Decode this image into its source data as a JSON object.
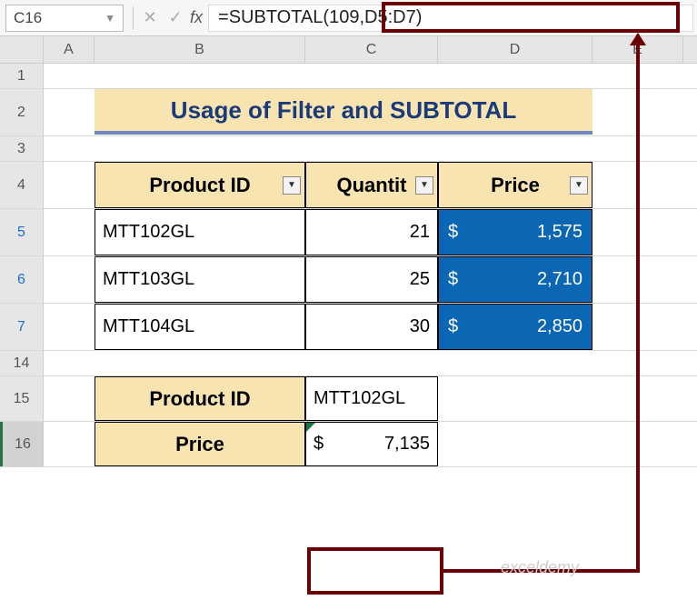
{
  "nameBox": "C16",
  "formula": "=SUBTOTAL(109,D5:D7)",
  "columns": [
    "A",
    "B",
    "C",
    "D",
    "E"
  ],
  "rowLabels": {
    "r1": "1",
    "r2": "2",
    "r3": "3",
    "r4": "4",
    "r5": "5",
    "r6": "6",
    "r7": "7",
    "r14": "14",
    "r15": "15",
    "r16": "16"
  },
  "title": "Usage of Filter and SUBTOTAL",
  "headers": {
    "product": "Product ID",
    "qty": "Quantit",
    "price": "Price"
  },
  "data": [
    {
      "id": "MTT102GL",
      "qty": "21",
      "cur": "$",
      "price": "1,575"
    },
    {
      "id": "MTT103GL",
      "qty": "25",
      "cur": "$",
      "price": "2,710"
    },
    {
      "id": "MTT104GL",
      "qty": "30",
      "cur": "$",
      "price": "2,850"
    }
  ],
  "summary": {
    "label1": "Product ID",
    "val1": "MTT102GL",
    "label2": "Price",
    "cur": "$",
    "val2": "7,135"
  },
  "watermark": "exceldemy",
  "chart_data": {
    "type": "table",
    "title": "Usage of Filter and SUBTOTAL",
    "columns": [
      "Product ID",
      "Quantity",
      "Price"
    ],
    "rows": [
      [
        "MTT102GL",
        21,
        1575
      ],
      [
        "MTT103GL",
        25,
        2710
      ],
      [
        "MTT104GL",
        30,
        2850
      ]
    ],
    "subtotal_formula": "=SUBTOTAL(109,D5:D7)",
    "subtotal_value": 7135
  }
}
